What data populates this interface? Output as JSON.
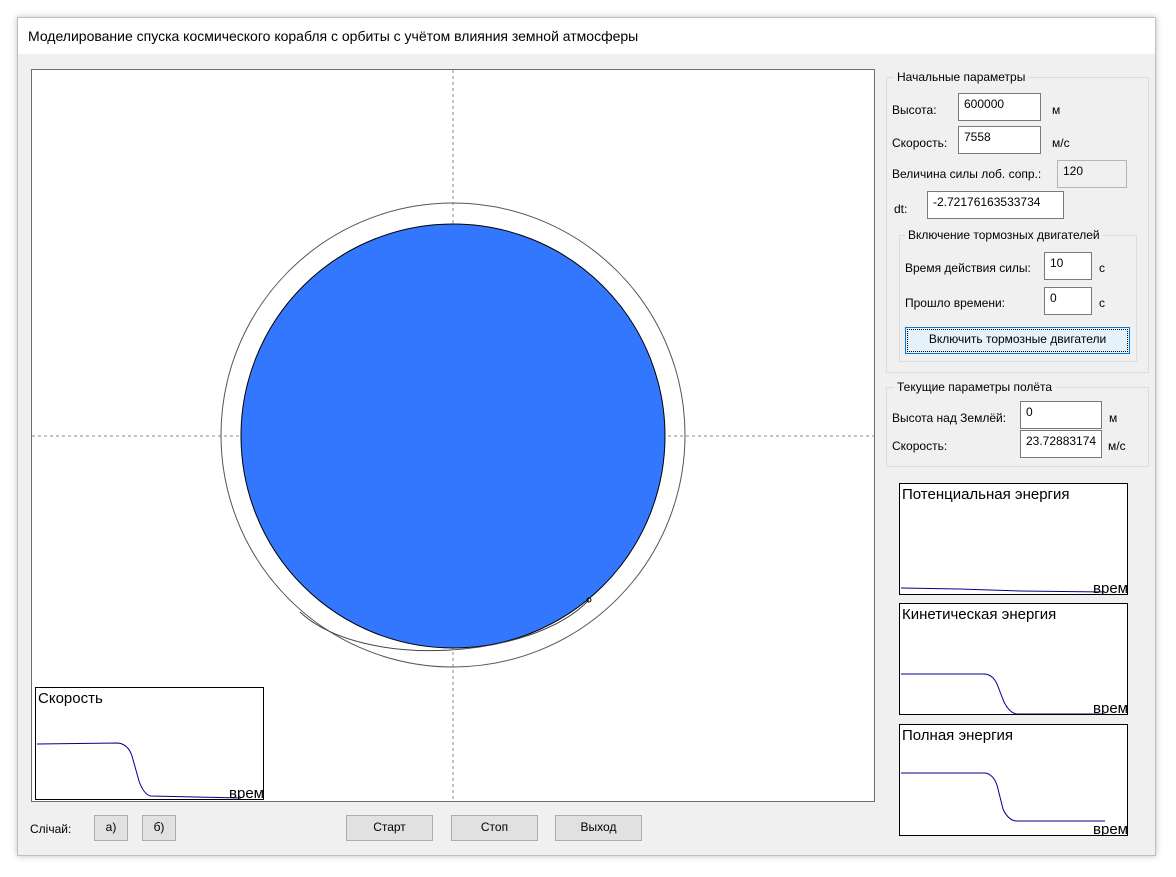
{
  "window": {
    "title": "Моделирование спуска космического корабля с орбиты с учётом влияния земной атмосферы"
  },
  "colors": {
    "earth": "#3377ff",
    "curve": "#00008b",
    "window_bg": "#f0f0f0"
  },
  "initial_params": {
    "legend": "Начальные параметры",
    "height_label": "Высота:",
    "height_value": "600000",
    "height_unit": "м",
    "speed_label": "Скорость:",
    "speed_value": "7558",
    "speed_unit": "м/с",
    "drag_label": "Величина силы лоб. сопр.:",
    "drag_value": "120",
    "dt_label": "dt:",
    "dt_value": "-2.72176163533734"
  },
  "brakes": {
    "legend": "Включение тормозных двигателей",
    "force_time_label": "Время действия силы:",
    "force_time_value": "10",
    "force_time_unit": "с",
    "elapsed_label": "Прошло времени:",
    "elapsed_value": "0",
    "elapsed_unit": "с",
    "button": "Включить тормозные двигатели"
  },
  "current_params": {
    "legend": "Текущие параметры полёта",
    "altitude_label": "Высота над Землёй:",
    "altitude_value": "0",
    "altitude_unit": "м",
    "speed_label": "Скорость:",
    "speed_value": "23.72883174",
    "speed_unit": "м/с"
  },
  "graphs": {
    "speed": {
      "title": "Скорость",
      "x_label": "врем"
    },
    "potential": {
      "title": "Потенциальная энергия",
      "x_label": "врем"
    },
    "kinetic": {
      "title": "Кинетическая энергия",
      "x_label": "врем"
    },
    "total": {
      "title": "Полная энергия",
      "x_label": "врем"
    }
  },
  "bottom": {
    "compare_label": "Слічай:",
    "case_a": "а)",
    "case_b": "б)",
    "start": "Старт",
    "stop": "Стоп",
    "exit": "Выход"
  }
}
